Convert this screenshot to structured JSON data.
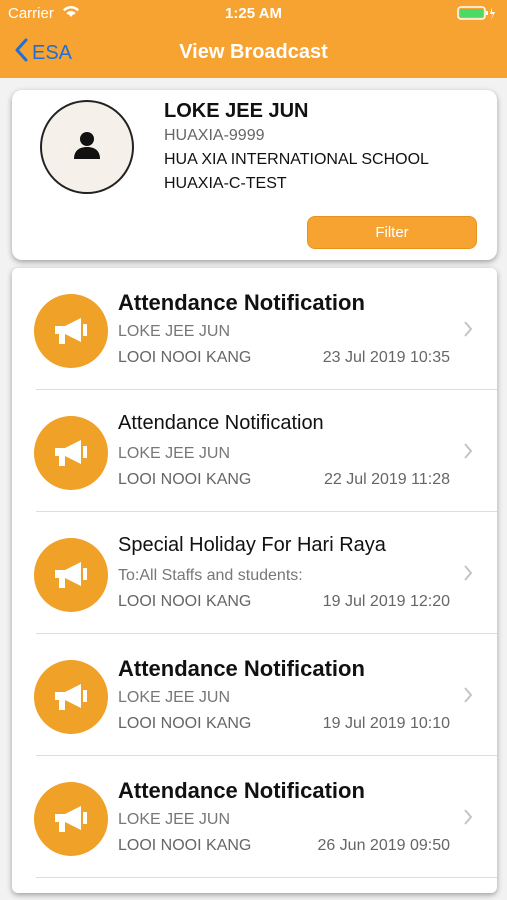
{
  "status_bar": {
    "carrier": "Carrier",
    "time": "1:25 AM"
  },
  "nav": {
    "back_label": "ESA",
    "title": "View Broadcast"
  },
  "profile": {
    "name": "LOKE JEE JUN",
    "student_id": "HUAXIA-9999",
    "school": "HUA XIA INTERNATIONAL SCHOOL",
    "code": "HUAXIA-C-TEST",
    "filter_label": "Filter"
  },
  "broadcasts": [
    {
      "title": "Attendance Notification",
      "subtitle": "LOKE JEE JUN",
      "sender": "LOOI NOOI KANG",
      "date": "23 Jul 2019 10:35",
      "unread": true
    },
    {
      "title": "Attendance Notification",
      "subtitle": "LOKE JEE JUN",
      "sender": "LOOI NOOI KANG",
      "date": "22 Jul 2019 11:28",
      "unread": false
    },
    {
      "title": "Special Holiday For Hari Raya",
      "subtitle": "To:All Staffs and students:",
      "sender": "LOOI NOOI KANG",
      "date": "19 Jul 2019 12:20",
      "unread": false
    },
    {
      "title": "Attendance Notification",
      "subtitle": "LOKE JEE JUN",
      "sender": "LOOI NOOI KANG",
      "date": "19 Jul 2019 10:10",
      "unread": true
    },
    {
      "title": "Attendance Notification",
      "subtitle": "LOKE JEE JUN",
      "sender": "LOOI NOOI KANG",
      "date": "26 Jun 2019 09:50",
      "unread": true
    }
  ],
  "colors": {
    "accent": "#f7a331",
    "back_link": "#1f6fd6",
    "icon_circle": "#efa128"
  },
  "icons": {
    "wifi": "wifi-icon",
    "battery": "battery-icon",
    "back": "chevron-left-icon",
    "avatar": "person-icon",
    "broadcast": "megaphone-icon",
    "disclosure": "chevron-right-icon"
  }
}
